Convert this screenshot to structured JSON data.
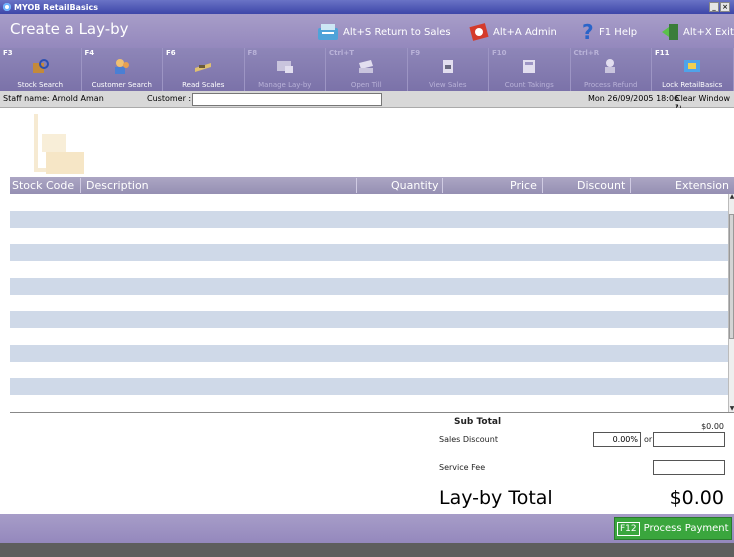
{
  "window": {
    "title": "MYOB RetailBasics",
    "min": "_",
    "close": "×"
  },
  "header": {
    "title": "Create a Lay-by",
    "actions": [
      {
        "label": "Alt+S Return to Sales",
        "icon": "return-sales-icon"
      },
      {
        "label": "Alt+A Admin",
        "icon": "admin-icon"
      },
      {
        "label": "F1 Help",
        "icon": "help-icon"
      },
      {
        "label": "Alt+X Exit",
        "icon": "exit-icon"
      }
    ]
  },
  "function_bar": [
    {
      "key": "F3",
      "label": "Stock Search",
      "enabled": true
    },
    {
      "key": "F4",
      "label": "Customer Search",
      "enabled": true
    },
    {
      "key": "F6",
      "label": "Read Scales",
      "enabled": true
    },
    {
      "key": "F8",
      "label": "Manage Lay-by",
      "enabled": false
    },
    {
      "key": "Ctrl+T",
      "label": "Open Till",
      "enabled": false
    },
    {
      "key": "F9",
      "label": "View Sales",
      "enabled": false
    },
    {
      "key": "F10",
      "label": "Count Takings",
      "enabled": false
    },
    {
      "key": "Ctrl+R",
      "label": "Process Refund",
      "enabled": false
    },
    {
      "key": "F11",
      "label": "Lock RetailBasics",
      "enabled": true
    }
  ],
  "staff_bar": {
    "staff": "Staff name: Arnold Aman",
    "customer_label": "Customer :",
    "customer_value": "",
    "datetime": "Mon 26/09/2005 18:06",
    "clear_window": "Clear Window"
  },
  "table": {
    "columns": [
      "Stock Code",
      "Description",
      "Quantity",
      "Price",
      "Discount",
      "Extension"
    ],
    "rows": []
  },
  "totals": {
    "subtotal_label": "Sub Total",
    "subtotal_value": "$0.00",
    "sales_discount_label": "Sales Discount",
    "discount_percent": "0.00%",
    "or_label": "or",
    "discount_amount": "",
    "service_fee_label": "Service Fee",
    "service_fee_value": "",
    "total_label": "Lay-by Total",
    "total_value": "$0.00"
  },
  "footer": {
    "process_key": "F12",
    "process_label": "Process Payment"
  },
  "colors": {
    "header": "#a79dc8",
    "function_bar": "#7b72a9",
    "row_alt": "#cfd9e8",
    "process_green": "#3aa63d"
  }
}
